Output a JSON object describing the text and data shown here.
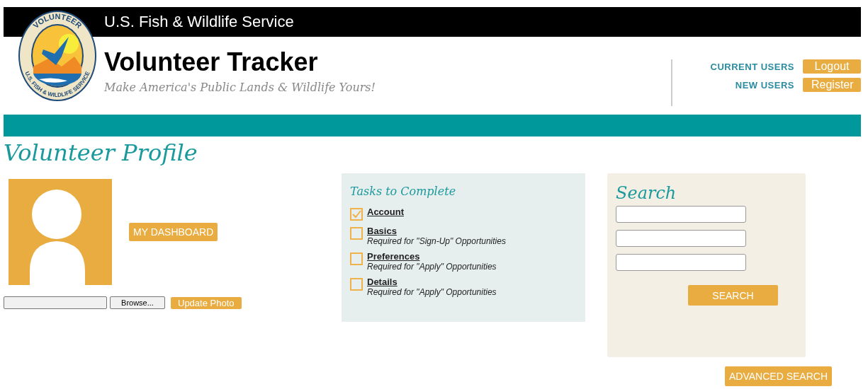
{
  "header": {
    "agency": "U.S. Fish & Wildlife Service",
    "logo": {
      "top_text": "VOLUNTEER",
      "bottom_text": "U.S. FISH & WILDLIFE SERVICE"
    },
    "title": "Volunteer Tracker",
    "tagline": "Make America's Public Lands & Wildlife Yours!",
    "user_links": [
      {
        "label": "CURRENT USERS",
        "button": "Logout"
      },
      {
        "label": "NEW USERS",
        "button": "Register"
      }
    ]
  },
  "page_title": "Volunteer Profile",
  "profile": {
    "dashboard_button": "MY DASHBOARD",
    "browse_button": "Browse...",
    "update_button": "Update Photo"
  },
  "tasks": {
    "title": "Tasks to Complete",
    "items": [
      {
        "label": "Account",
        "checked": true
      },
      {
        "label": "Basics",
        "note": "Required for \"Sign-Up\" Opportunities",
        "checked": false
      },
      {
        "label": "Preferences",
        "note": "Required for \"Apply\" Opportunities",
        "checked": false
      },
      {
        "label": "Details",
        "note": "Required for \"Apply\" Opportunities",
        "checked": false
      }
    ]
  },
  "search": {
    "title": "Search",
    "button": "SEARCH",
    "advanced_button": "ADVANCED SEARCH"
  }
}
